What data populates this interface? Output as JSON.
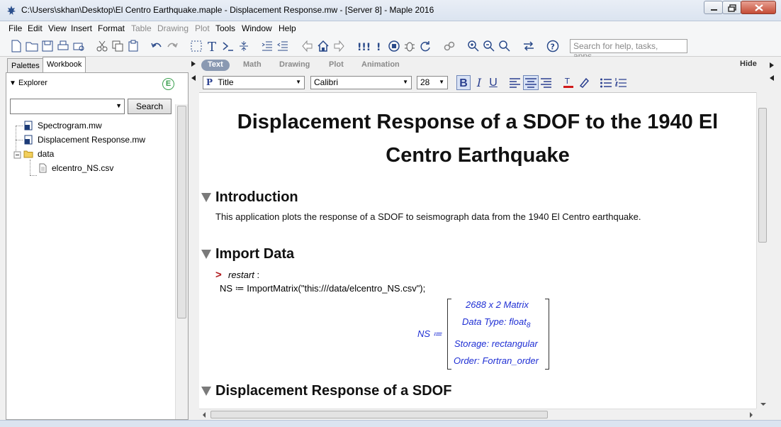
{
  "window": {
    "title": "C:\\Users\\skhan\\Desktop\\El Centro Earthquake.maple - Displacement Response.mw - [Server 8] - Maple 2016"
  },
  "menu": [
    "File",
    "Edit",
    "View",
    "Insert",
    "Format",
    "Table",
    "Drawing",
    "Plot",
    "Tools",
    "Window",
    "Help"
  ],
  "toolbar": {
    "search_placeholder": "Search for help, tasks, apps..."
  },
  "left_panel": {
    "tabs": [
      "Palettes",
      "Workbook"
    ],
    "explorer_label": "Explorer",
    "badge": "E",
    "search_button": "Search",
    "tree": {
      "spectrogram": "Spectrogram.mw",
      "displacement": "Displacement Response.mw",
      "data_folder": "data",
      "csv": "elcentro_NS.csv"
    }
  },
  "context_bar": {
    "tabs": [
      "Text",
      "Math",
      "Drawing",
      "Plot",
      "Animation"
    ],
    "hide": "Hide",
    "style_value": "Title",
    "style_prefix": "P",
    "font_value": "Calibri",
    "size_value": "28"
  },
  "document": {
    "title": "Displacement Response of a SDOF to the 1940 El Centro Earthquake",
    "intro_heading": "Introduction",
    "intro_text": "This application plots the response of a SDOF to seismograph data from the 1940 El Centro earthquake.",
    "import_heading": "Import Data",
    "prompt": ">",
    "code_line1_cmd": "restart",
    "code_line1_suffix": " :",
    "code_line2": "NS ≔ ImportMatrix(\"this:///data/elcentro_NS.csv\");",
    "output_lhs": "NS ≔",
    "output_lines": {
      "size": "2688 x 2 Matrix",
      "datatype": "Data Type: float",
      "datatype_sub": "8",
      "storage": "Storage: rectangular",
      "order": "Order: Fortran_order"
    },
    "displacement_heading": "Displacement Response of a SDOF"
  },
  "colors": {
    "prompt": "#b0181c",
    "output": "#1f2fd4",
    "active_tab": "#8a99b2"
  }
}
